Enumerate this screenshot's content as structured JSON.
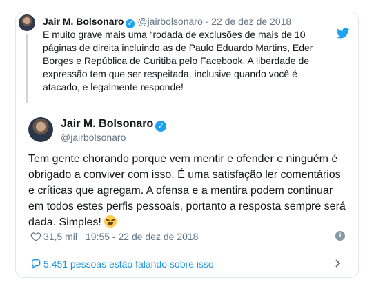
{
  "parent_tweet": {
    "author_name": "Jair M. Bolsonaro",
    "handle": "@jairbolsonaro",
    "date": "22 de dez de 2018",
    "text": "É muito grave mais uma “rodada de exclusões de mais de 10 páginas de direita incluindo as de Paulo Eduardo Martins, Eder Borges e República de Curitiba pelo Facebook. A liberdade de expressão tem que ser respeitada, inclusive quando você é atacado, e legalmente responde!"
  },
  "main_tweet": {
    "author_name": "Jair M. Bolsonaro",
    "handle": "@jairbolsonaro",
    "text": "Tem gente chorando porque vem mentir e ofender e ninguém é obrigado a conviver com isso. É uma satisfação ler comentários e críticas que agregam. A ofensa e a mentira podem continuar em todos estes perfis pessoais, portanto a resposta sempre será dada. Simples!",
    "likes": "31,5 mil",
    "timestamp": "19:55 - 22 de dez de 2018"
  },
  "footer": {
    "talking_label": "5.451 pessoas estão falando sobre isso"
  },
  "colors": {
    "accent": "#1da1f2",
    "link": "#1b95e0",
    "muted": "#657786",
    "border": "#e1e8ed"
  },
  "icons": [
    "twitter-bird-icon",
    "verified-badge-icon",
    "heart-icon",
    "info-icon",
    "comment-bubble-icon",
    "chevron-right-icon",
    "laughing-emoji-icon"
  ]
}
